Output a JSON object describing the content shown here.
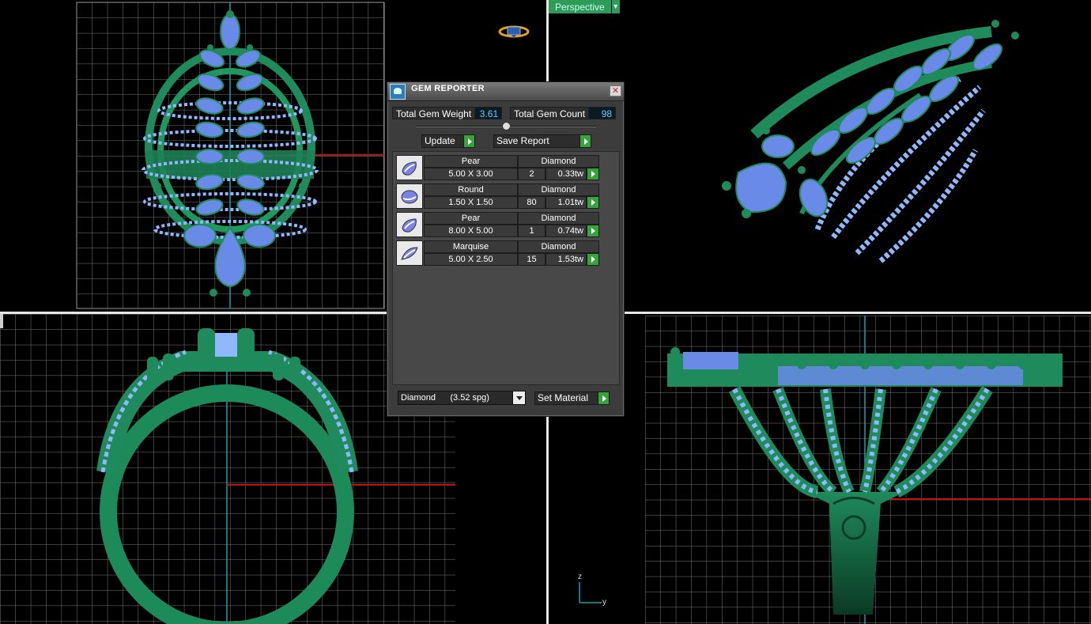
{
  "viewports": {
    "perspective_label": "Perspective",
    "axis_z": "z",
    "axis_y": "y"
  },
  "dialog": {
    "title": "GEM REPORTER",
    "close_glyph": "✕",
    "total_gem_weight_label": "Total Gem Weight",
    "total_gem_weight": "3.61",
    "total_gem_count_label": "Total Gem Count",
    "total_gem_count": "98",
    "update_label": "Update",
    "save_report_label": "Save Report",
    "gems": [
      {
        "shape": "Pear",
        "material": "Diamond",
        "size": "5.00 X 3.00",
        "count": "2",
        "weight": "0.33tw",
        "icon": "pear-gem-icon"
      },
      {
        "shape": "Round",
        "material": "Diamond",
        "size": "1.50 X 1.50",
        "count": "80",
        "weight": "1.01tw",
        "icon": "round-gem-icon"
      },
      {
        "shape": "Pear",
        "material": "Diamond",
        "size": "8.00 X 5.00",
        "count": "1",
        "weight": "0.74tw",
        "icon": "pear-gem-icon"
      },
      {
        "shape": "Marquise",
        "material": "Diamond",
        "size": "5.00 X 2.50",
        "count": "15",
        "weight": "1.53tw",
        "icon": "marquise-gem-icon"
      }
    ],
    "material_select_value": "Diamond      (3.52 spg)",
    "set_material_label": "Set Material"
  },
  "colors": {
    "metal_green": "#1f8a5c",
    "gem_blue": "#6a8ae8",
    "grid": "#7a7a7a",
    "axis_red": "#c01010",
    "axis_cyan": "#1aa0b0",
    "accent_green": "#35a43a"
  }
}
